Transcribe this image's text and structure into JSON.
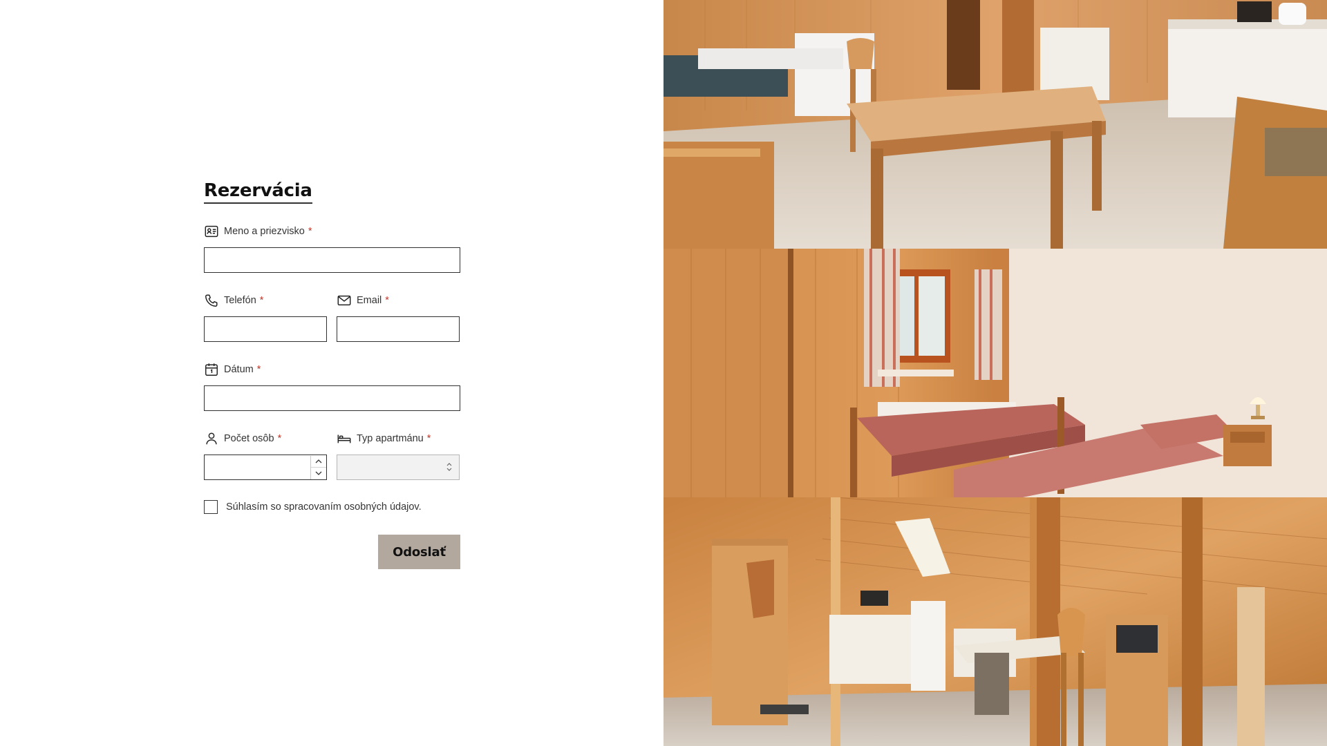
{
  "form": {
    "title": "Rezervácia",
    "required_mark": "*",
    "fields": {
      "name": {
        "label": "Meno a priezvisko",
        "icon": "id-card-icon",
        "value": ""
      },
      "phone": {
        "label": "Telefón",
        "icon": "phone-icon",
        "value": ""
      },
      "email": {
        "label": "Email",
        "icon": "envelope-icon",
        "value": ""
      },
      "date": {
        "label": "Dátum",
        "icon": "calendar-icon",
        "value": ""
      },
      "persons": {
        "label": "Počet osôb",
        "icon": "person-icon",
        "value": ""
      },
      "apartment": {
        "label": "Typ apartmánu",
        "icon": "bed-icon",
        "selected": ""
      }
    },
    "consent": {
      "label": "Súhlasím so spracovaním osobných údajov.",
      "checked": false
    },
    "submit_label": "Odoslať"
  },
  "gallery": {
    "photos": [
      {
        "subject": "kitchen-dining-room-photo"
      },
      {
        "subject": "twin-bedroom-photo"
      },
      {
        "subject": "attic-studio-photo"
      }
    ]
  },
  "colors": {
    "submit_bg": "#b2a89d",
    "required": "#c0392b",
    "wood": "#d08a4a"
  }
}
